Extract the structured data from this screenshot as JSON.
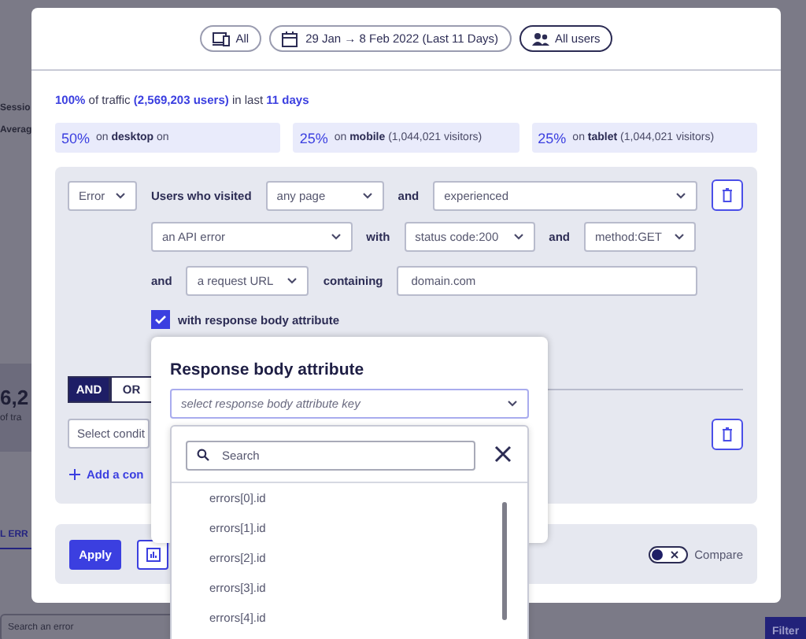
{
  "backdrop": {
    "left_labels": [
      "Sessio",
      "Averag"
    ],
    "metric": "6,2",
    "metric_caption": "of tra",
    "tab": "L ERR",
    "search": {
      "placeholder": "Search an error"
    },
    "filter_button": "Filter"
  },
  "modal": {
    "chips": [
      {
        "kind": "device",
        "label": "All",
        "selected": false
      },
      {
        "kind": "date",
        "label": "29 Jan → 8 Feb 2022 (Last 11 Days)",
        "selected": false
      },
      {
        "kind": "users",
        "label": "All users",
        "selected": true
      }
    ],
    "traffic": "**100%** of traffic **(2,569,203 users)** in last **11 days**",
    "segments": [
      {
        "share": "50%",
        "text": "on **desktop** on"
      },
      {
        "share": "25%",
        "text": "on **mobile** (1,044,021 visitors)"
      },
      {
        "share": "25%",
        "text": "on **tablet** (1,044,021 visitors)"
      }
    ],
    "condition_rows": [
      [
        {
          "kind": "select",
          "value": "Error"
        },
        {
          "kind": "text",
          "label": "Users who visited"
        },
        {
          "kind": "select",
          "value": "any page"
        },
        {
          "kind": "text",
          "label": "and"
        },
        {
          "kind": "select",
          "value": "experienced"
        },
        {
          "kind": "delete"
        }
      ],
      [
        {
          "kind": "select",
          "value": "an API error"
        },
        {
          "kind": "text",
          "label": "with"
        },
        {
          "kind": "select",
          "value": "status code:200"
        },
        {
          "kind": "text",
          "label": "and"
        },
        {
          "kind": "select",
          "value": "method:GET"
        }
      ],
      [
        {
          "kind": "text",
          "label": "and"
        },
        {
          "kind": "select",
          "value": "a request URL"
        },
        {
          "kind": "text",
          "label": "containing"
        },
        {
          "kind": "input",
          "value": "domain.com"
        }
      ]
    ],
    "checkbox": {
      "label": "with response body attribute",
      "checked": true
    },
    "logic": [
      {
        "label": "AND",
        "selected": true
      },
      {
        "label": "OR",
        "selected": false
      }
    ],
    "second_condition": {
      "select": {
        "placeholder": "Select condit"
      },
      "add_link": "Add a con"
    },
    "apply_button": "Apply",
    "compare": {
      "label": "Compare",
      "on": false
    }
  },
  "popup": {
    "title": "Response body attribute",
    "select": {
      "placeholder": "select response body attribute key"
    },
    "dropdown": {
      "search": {
        "placeholder": "Search"
      },
      "items": [
        "errors[0].id",
        "errors[1].id",
        "errors[2].id",
        "errors[3].id",
        "errors[4].id"
      ]
    }
  }
}
